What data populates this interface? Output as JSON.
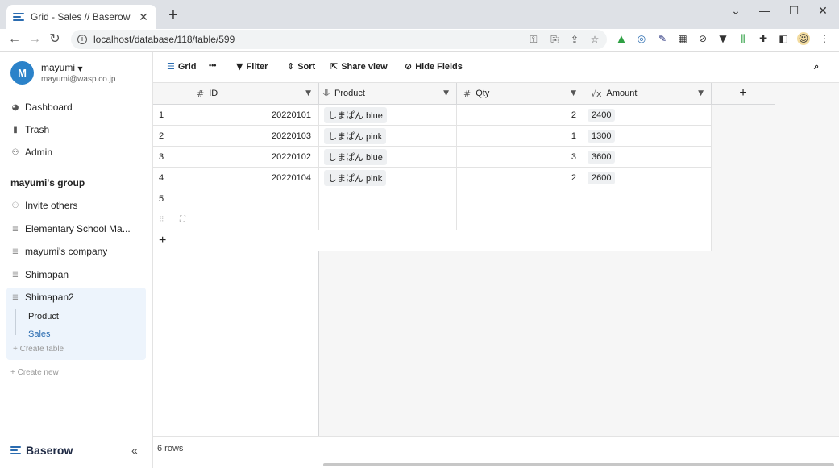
{
  "browser": {
    "tab_title": "Grid - Sales // Baserow",
    "tab_close": "✕",
    "new_tab": "+",
    "url": "localhost/database/118/table/599",
    "window_controls": {
      "dropdown": "⌄",
      "minimize": "—",
      "maximize": "☐",
      "close": "✕"
    }
  },
  "sidebar": {
    "avatar_letter": "M",
    "user_name": "mayumi",
    "user_email": "mayumi@wasp.co.jp",
    "nav": [
      {
        "label": "Dashboard",
        "icon": "dashboard-icon"
      },
      {
        "label": "Trash",
        "icon": "trash-icon"
      },
      {
        "label": "Admin",
        "icon": "admin-icon"
      }
    ],
    "group_title": "mayumi's group",
    "invite_label": "Invite others",
    "databases": [
      {
        "label": "Elementary School Ma...",
        "icon": "database-icon"
      },
      {
        "label": "mayumi's company",
        "icon": "database-icon"
      },
      {
        "label": "Shimapan",
        "icon": "database-icon"
      },
      {
        "label": "Shimapan2",
        "icon": "database-icon"
      }
    ],
    "tables": [
      {
        "label": "Product"
      },
      {
        "label": "Sales"
      }
    ],
    "create_table": "Create table",
    "create_new": "Create new",
    "brand": "Baserow",
    "collapse": "«"
  },
  "toolbar": {
    "grid": "Grid",
    "more": "•••",
    "filter": "Filter",
    "sort": "Sort",
    "share_view": "Share view",
    "hide_fields": "Hide Fields"
  },
  "grid": {
    "columns": {
      "id": "ID",
      "product": "Product",
      "qty": "Qty",
      "amount": "Amount",
      "add": "+"
    },
    "rows": [
      {
        "num": "1",
        "id": "20220101",
        "product": "しまぱん blue",
        "qty": "2",
        "amount": "2400"
      },
      {
        "num": "2",
        "id": "20220103",
        "product": "しまぱん pink",
        "qty": "1",
        "amount": "1300"
      },
      {
        "num": "3",
        "id": "20220102",
        "product": "しまぱん blue",
        "qty": "3",
        "amount": "3600"
      },
      {
        "num": "4",
        "id": "20220104",
        "product": "しまぱん pink",
        "qty": "2",
        "amount": "2600"
      },
      {
        "num": "5",
        "id": "",
        "product": "",
        "qty": "",
        "amount": ""
      }
    ],
    "add_row": "+",
    "row_count": "6 rows"
  }
}
